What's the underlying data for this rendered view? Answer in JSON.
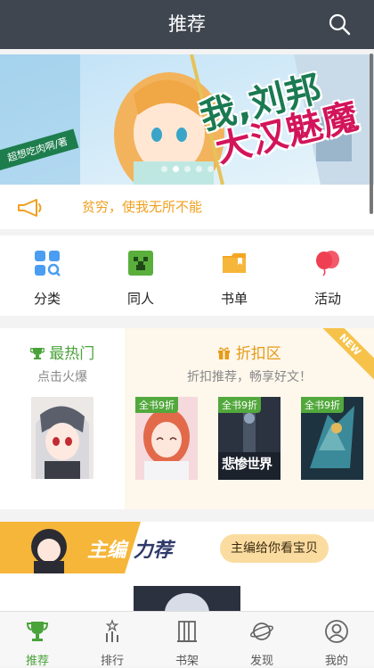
{
  "header": {
    "title": "推荐"
  },
  "banner": {
    "title_line1": "我,刘邦",
    "title_line2": "大汉魅魔",
    "author": "超想吃肉啊/著",
    "dots": 5,
    "active_dot": 1
  },
  "notice": {
    "text": "贫穷，使我无所不能"
  },
  "categories": [
    {
      "label": "分类",
      "icon": "category-search-icon",
      "color": "#4a9df0"
    },
    {
      "label": "同人",
      "icon": "creeper-icon",
      "color": "#5aaf3c"
    },
    {
      "label": "书单",
      "icon": "book-list-icon",
      "color": "#f4a623"
    },
    {
      "label": "活动",
      "icon": "balloon-icon",
      "color": "#f04a5a"
    }
  ],
  "hot": {
    "title": "最热门",
    "subtitle": "点击火爆"
  },
  "discount": {
    "title": "折扣区",
    "subtitle": "折扣推荐，畅享好文！",
    "ribbon": "NEW",
    "books": [
      {
        "badge": "全书9折"
      },
      {
        "badge": "全书9折",
        "cover_text": "悲惨世界"
      },
      {
        "badge": "全书9折"
      }
    ]
  },
  "editor": {
    "title_a": "主编",
    "title_b": "力荐",
    "button": "主编给你看宝贝"
  },
  "tabs": [
    {
      "label": "推荐",
      "icon": "trophy-icon",
      "active": true
    },
    {
      "label": "排行",
      "icon": "ranking-icon",
      "active": false
    },
    {
      "label": "书架",
      "icon": "bookshelf-icon",
      "active": false
    },
    {
      "label": "发现",
      "icon": "planet-icon",
      "active": false
    },
    {
      "label": "我的",
      "icon": "profile-icon",
      "active": false
    }
  ],
  "colors": {
    "header": "#3f4650",
    "accent_green": "#4aa33a",
    "accent_orange": "#f0a020"
  }
}
